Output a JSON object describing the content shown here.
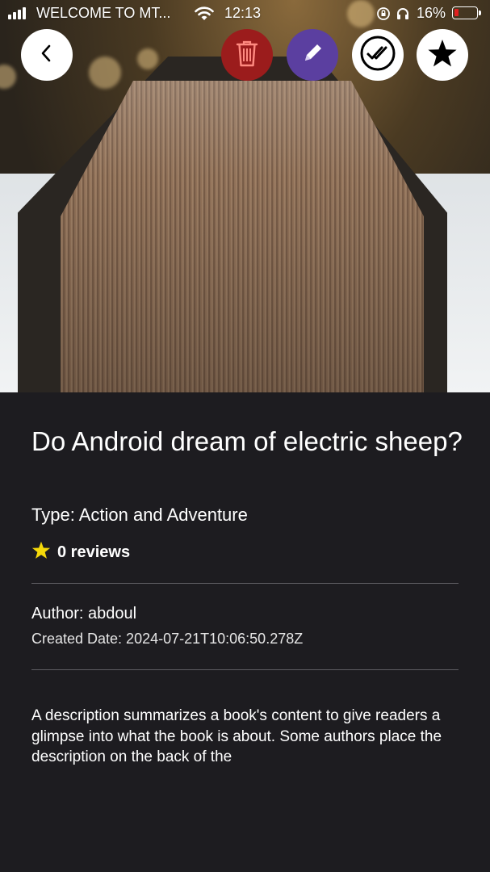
{
  "status_bar": {
    "carrier": "WELCOME TO MT...",
    "time": "12:13",
    "battery": "16%",
    "battery_level_fraction": 0.16
  },
  "hero": {
    "image_icon": "book-cover-photo"
  },
  "toolbar": {
    "back_icon": "chevron-left-icon",
    "delete_icon": "trash-icon",
    "edit_icon": "pencil-icon",
    "done_icon": "double-check-icon",
    "favorite_icon": "star-icon",
    "colors": {
      "delete": "#9b1c1c",
      "edit": "#5b3fa0",
      "neutral": "#ffffff"
    }
  },
  "book": {
    "title": "Do Android dream of electric sheep?",
    "type_line": "Type: Action and Adventure",
    "reviews": "0 reviews",
    "author_line": "Author: abdoul",
    "created_line": "Created Date: 2024-07-21T10:06:50.278Z",
    "description": "A description summarizes a book's content to give readers a glimpse into what the book is about. Some authors place the description on the back of the"
  },
  "theme": {
    "background": "#1d1c20",
    "star": "#f5d90a",
    "divider": "#5e5d62"
  }
}
